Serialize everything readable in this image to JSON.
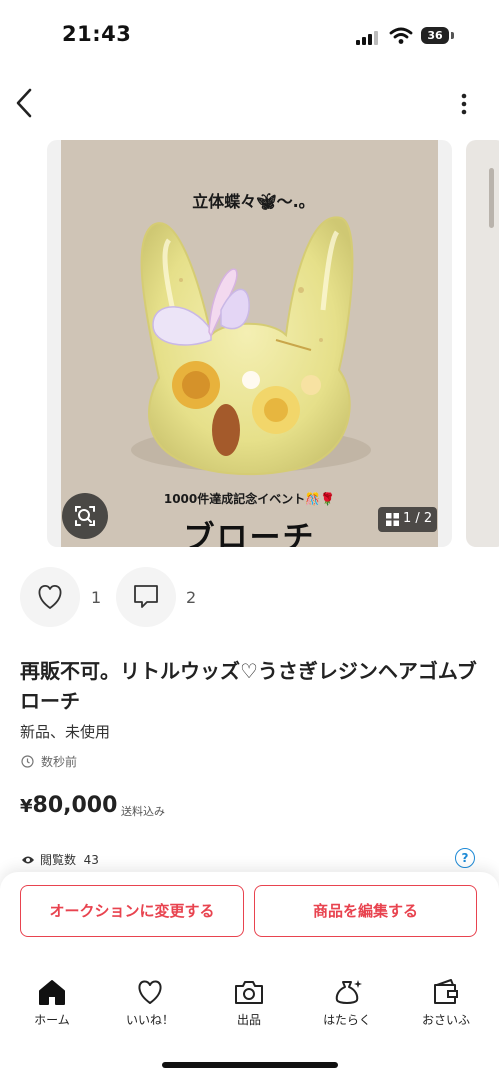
{
  "status_bar": {
    "time": "21:43",
    "battery": "36"
  },
  "photo": {
    "title_text": "立体蝶々🦋︎〜.｡",
    "event_text": "1000件達成記念イベント🎊🌹",
    "caption": "ブローチ",
    "page_counter": "1 / 2"
  },
  "social": {
    "likes": "1",
    "comments": "2"
  },
  "item": {
    "title": "再販不可。リトルウッズ♡うさぎレジンヘアゴムブローチ",
    "condition": "新品、未使用",
    "posted": "数秒前",
    "price_symbol": "¥",
    "price": "80,000",
    "shipping": "送料込み",
    "views_label": "閲覧数",
    "views": "43",
    "help": "?"
  },
  "actions": {
    "auction": "オークションに変更する",
    "edit": "商品を編集する"
  },
  "tabs": [
    {
      "label": "ホーム",
      "icon": "home-icon"
    },
    {
      "label": "いいね！",
      "icon": "heart-icon"
    },
    {
      "label": "出品",
      "icon": "camera-icon"
    },
    {
      "label": "はたらく",
      "icon": "money-bag-icon"
    },
    {
      "label": "おさいふ",
      "icon": "wallet-icon"
    }
  ],
  "colors": {
    "accent": "#e8434f",
    "link": "#1e8ad6"
  }
}
